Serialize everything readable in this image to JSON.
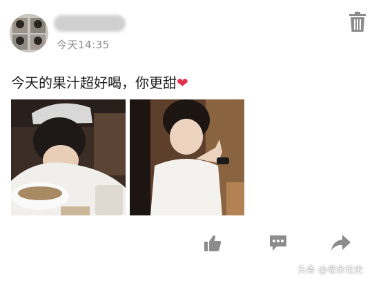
{
  "post": {
    "timestamp": "今天14:35",
    "text": "今天的果汁超好喝，你更甜",
    "emoji": "❤"
  },
  "icons": {
    "delete": "trash-icon",
    "like": "thumbs-up-icon",
    "comment": "comment-icon",
    "share": "share-icon"
  },
  "watermark": {
    "text": "头条 @老余论史"
  },
  "colors": {
    "icon_gray": "#8c8c8c",
    "text_dark": "#1a1a1a",
    "timestamp_gray": "#8a8a8a",
    "heart": "#e2304a"
  }
}
